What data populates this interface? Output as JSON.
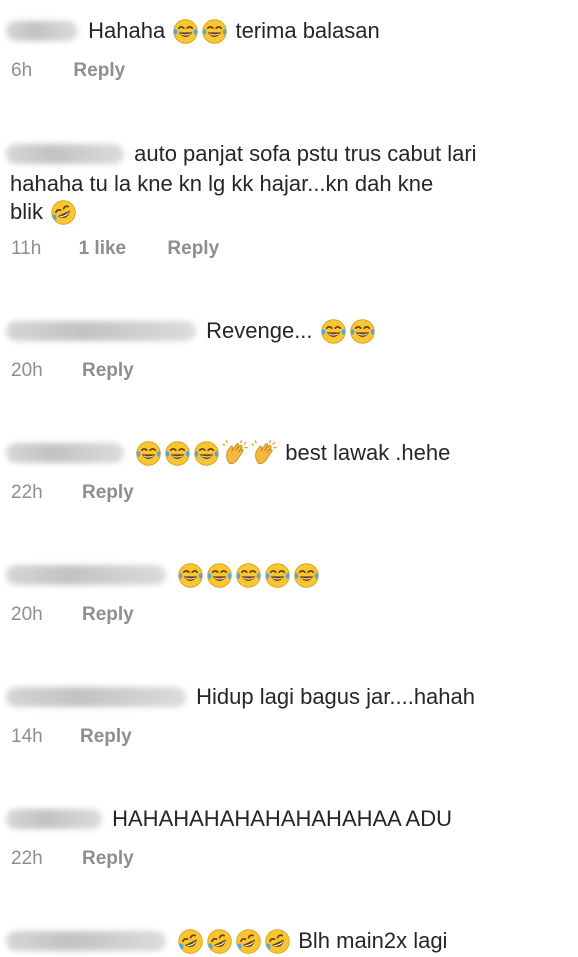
{
  "comments": [
    {
      "text_before": "Hahaha",
      "emojis": [
        "face-with-tears-of-joy",
        "face-with-tears-of-joy"
      ],
      "text_after": "terima balasan",
      "time": "6h",
      "likes": "",
      "reply_label": "Reply"
    },
    {
      "text_line1": "auto panjat sofa pstu trus cabut lari",
      "text_line2": "hahaha tu la kne kn lg kk hajar...kn dah kne",
      "text_line3": "blik",
      "emojis": [
        "rolling-on-floor-laughing"
      ],
      "time": "11h",
      "likes": "1 like",
      "reply_label": "Reply"
    },
    {
      "text_before": "Revenge...",
      "emojis": [
        "face-with-tears-of-joy",
        "face-with-tears-of-joy"
      ],
      "time": "20h",
      "likes": "",
      "reply_label": "Reply"
    },
    {
      "emojis": [
        "face-with-tears-of-joy",
        "face-with-tears-of-joy",
        "face-with-tears-of-joy",
        "clapping-hands",
        "clapping-hands"
      ],
      "text_after": "best lawak .hehe",
      "time": "22h",
      "likes": "",
      "reply_label": "Reply"
    },
    {
      "emojis": [
        "face-with-tears-of-joy",
        "face-with-tears-of-joy",
        "face-with-tears-of-joy",
        "face-with-tears-of-joy",
        "face-with-tears-of-joy"
      ],
      "time": "20h",
      "likes": "",
      "reply_label": "Reply"
    },
    {
      "text_before": "Hidup lagi bagus jar....hahah",
      "time": "14h",
      "likes": "",
      "reply_label": "Reply"
    },
    {
      "text_before": "HAHAHAHAHAHAHAHAHAA ADU",
      "time": "22h",
      "likes": "",
      "reply_label": "Reply"
    },
    {
      "emojis": [
        "rolling-on-floor-laughing",
        "rolling-on-floor-laughing",
        "rolling-on-floor-laughing",
        "rolling-on-floor-laughing"
      ],
      "text_after": "Blh main2x lagi"
    }
  ]
}
